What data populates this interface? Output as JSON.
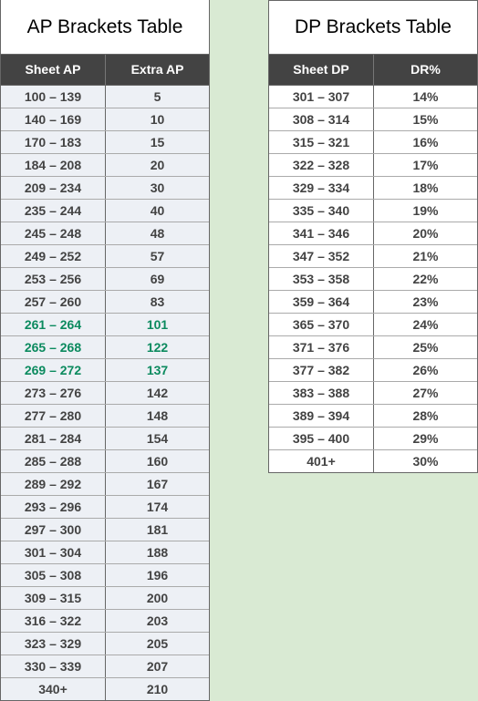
{
  "ap_table": {
    "title": "AP Brackets Table",
    "headers": [
      "Sheet AP",
      "Extra AP"
    ],
    "highlight_color": "#0b8a5e",
    "rows": [
      {
        "range": "100 – 139",
        "value": "5",
        "highlight": false
      },
      {
        "range": "140 – 169",
        "value": "10",
        "highlight": false
      },
      {
        "range": "170 – 183",
        "value": "15",
        "highlight": false
      },
      {
        "range": "184 – 208",
        "value": "20",
        "highlight": false
      },
      {
        "range": "209 – 234",
        "value": "30",
        "highlight": false
      },
      {
        "range": "235 – 244",
        "value": "40",
        "highlight": false
      },
      {
        "range": "245 – 248",
        "value": "48",
        "highlight": false
      },
      {
        "range": "249 – 252",
        "value": "57",
        "highlight": false
      },
      {
        "range": "253 – 256",
        "value": "69",
        "highlight": false
      },
      {
        "range": "257 – 260",
        "value": "83",
        "highlight": false
      },
      {
        "range": "261 – 264",
        "value": "101",
        "highlight": true
      },
      {
        "range": "265 – 268",
        "value": "122",
        "highlight": true
      },
      {
        "range": "269 – 272",
        "value": "137",
        "highlight": true
      },
      {
        "range": "273 – 276",
        "value": "142",
        "highlight": false
      },
      {
        "range": "277 – 280",
        "value": "148",
        "highlight": false
      },
      {
        "range": "281 – 284",
        "value": "154",
        "highlight": false
      },
      {
        "range": "285 – 288",
        "value": "160",
        "highlight": false
      },
      {
        "range": "289 – 292",
        "value": "167",
        "highlight": false
      },
      {
        "range": "293 – 296",
        "value": "174",
        "highlight": false
      },
      {
        "range": "297 – 300",
        "value": "181",
        "highlight": false
      },
      {
        "range": "301 – 304",
        "value": "188",
        "highlight": false
      },
      {
        "range": "305 – 308",
        "value": "196",
        "highlight": false
      },
      {
        "range": "309 – 315",
        "value": "200",
        "highlight": false
      },
      {
        "range": "316 – 322",
        "value": "203",
        "highlight": false
      },
      {
        "range": "323 – 329",
        "value": "205",
        "highlight": false
      },
      {
        "range": "330 – 339",
        "value": "207",
        "highlight": false
      },
      {
        "range": "340+",
        "value": "210",
        "highlight": false
      }
    ]
  },
  "dp_table": {
    "title": "DP Brackets Table",
    "headers": [
      "Sheet DP",
      "DR%"
    ],
    "rows": [
      {
        "range": "301 – 307",
        "value": "14%"
      },
      {
        "range": "308 – 314",
        "value": "15%"
      },
      {
        "range": "315 – 321",
        "value": "16%"
      },
      {
        "range": "322 – 328",
        "value": "17%"
      },
      {
        "range": "329 – 334",
        "value": "18%"
      },
      {
        "range": "335 – 340",
        "value": "19%"
      },
      {
        "range": "341 – 346",
        "value": "20%"
      },
      {
        "range": "347 – 352",
        "value": "21%"
      },
      {
        "range": "353 – 358",
        "value": "22%"
      },
      {
        "range": "359 – 364",
        "value": "23%"
      },
      {
        "range": "365 – 370",
        "value": "24%"
      },
      {
        "range": "371 – 376",
        "value": "25%"
      },
      {
        "range": "377 – 382",
        "value": "26%"
      },
      {
        "range": "383 – 388",
        "value": "27%"
      },
      {
        "range": "389 – 394",
        "value": "28%"
      },
      {
        "range": "395 – 400",
        "value": "29%"
      },
      {
        "range": "401+",
        "value": "30%"
      }
    ]
  }
}
